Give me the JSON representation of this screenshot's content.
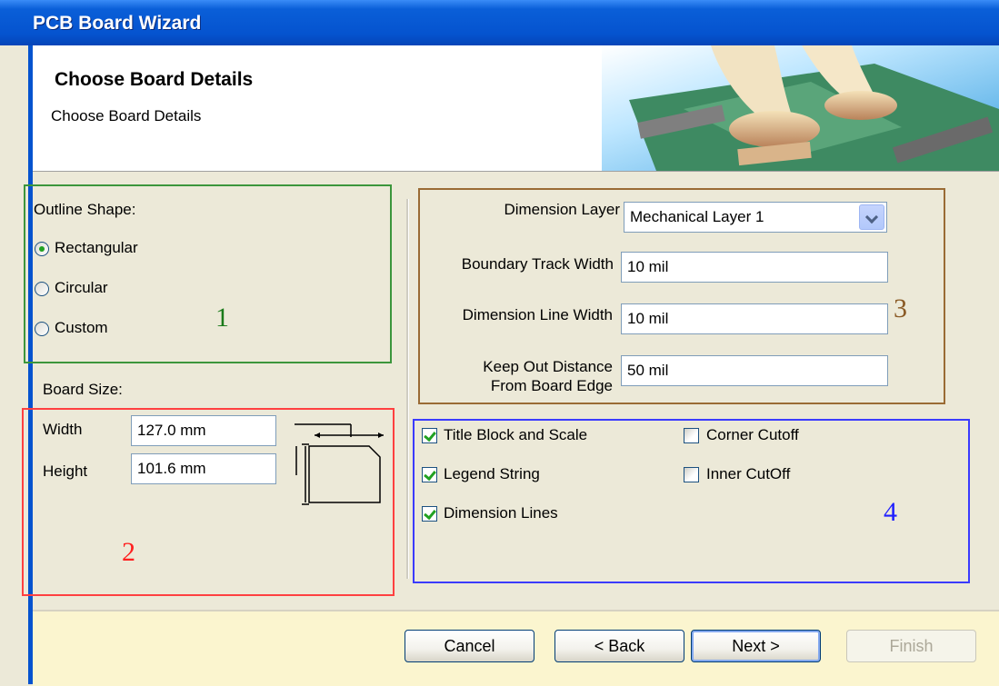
{
  "window": {
    "title": "PCB Board Wizard"
  },
  "header": {
    "heading": "Choose Board Details",
    "subheading": "Choose Board Details"
  },
  "outline": {
    "label": "Outline Shape:",
    "options": [
      {
        "label": "Rectangular",
        "selected": true
      },
      {
        "label": "Circular",
        "selected": false
      },
      {
        "label": "Custom",
        "selected": false
      }
    ],
    "marker": "1"
  },
  "board_size": {
    "label": "Board Size:",
    "width_label": "Width",
    "width_value": "127.0 mm",
    "height_label": "Height",
    "height_value": "101.6 mm",
    "marker": "2"
  },
  "layers": {
    "dimension_layer_label": "Dimension Layer",
    "dimension_layer_value": "Mechanical Layer 1",
    "boundary_track_label": "Boundary Track Width",
    "boundary_track_value": "10 mil",
    "dimension_line_label": "Dimension Line Width",
    "dimension_line_value": "10 mil",
    "keepout_label_1": "Keep Out Distance",
    "keepout_label_2": "From Board Edge",
    "keepout_value": "50 mil",
    "marker": "3"
  },
  "options": {
    "title_block": "Title Block and Scale",
    "legend_string": "Legend String",
    "dimension_lines": "Dimension Lines",
    "corner_cutoff": "Corner Cutoff",
    "inner_cutoff": "Inner CutOff",
    "marker": "4"
  },
  "buttons": {
    "cancel": "Cancel",
    "back": "< Back",
    "next": "Next >",
    "finish": "Finish"
  },
  "colors": {
    "box1": "#3c963c",
    "box2": "#ff4040",
    "box3": "#9a6b35",
    "box4": "#3b3bff",
    "marker1": "#1a7a1a",
    "marker2": "#ff2020",
    "marker3": "#8a5a25",
    "marker4": "#2020ff"
  }
}
